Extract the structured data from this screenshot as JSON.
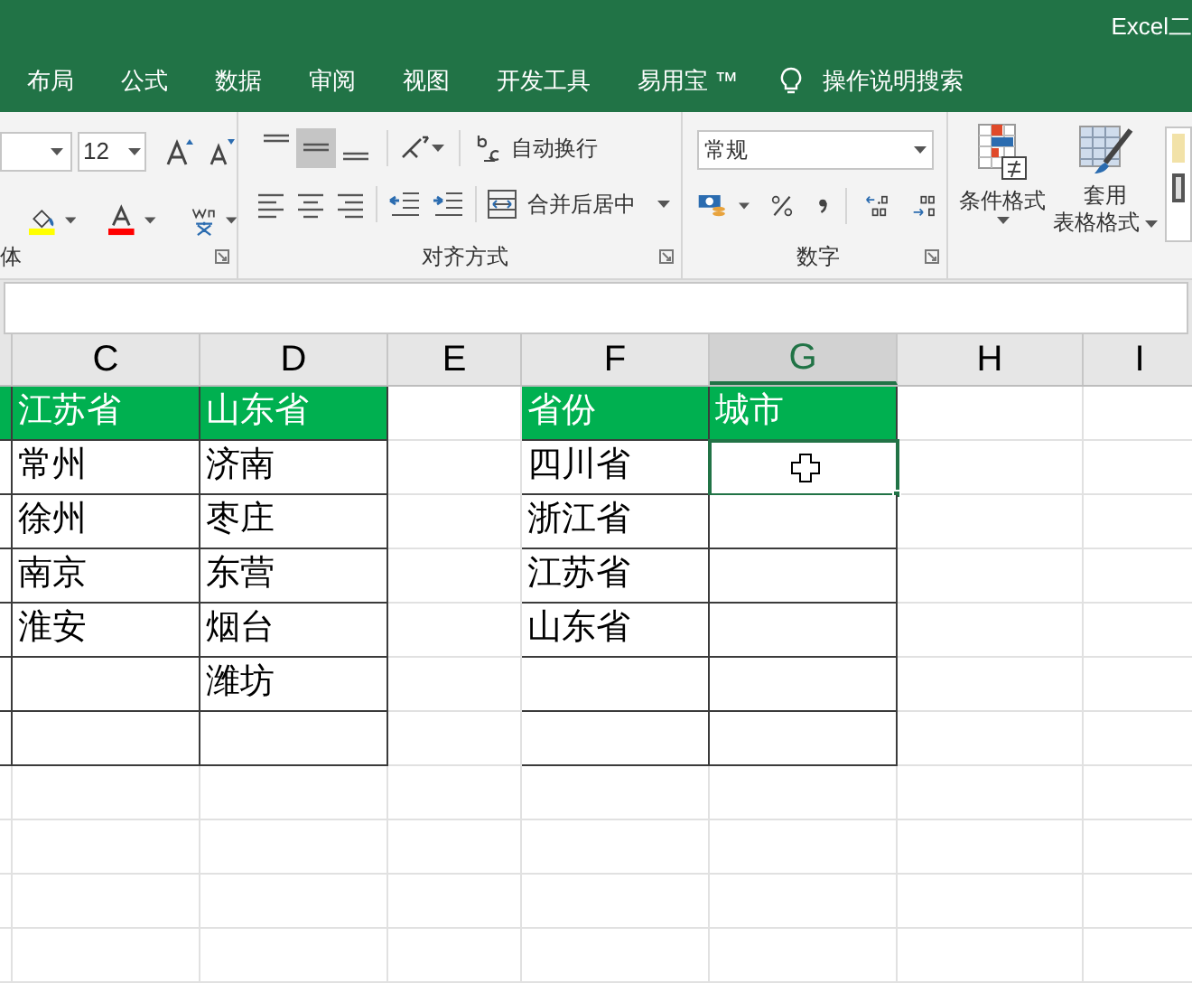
{
  "window": {
    "title": "Excel二"
  },
  "ribbon_tabs": [
    {
      "label": "布局",
      "selected": false
    },
    {
      "label": "公式",
      "selected": false
    },
    {
      "label": "数据",
      "selected": false
    },
    {
      "label": "审阅",
      "selected": false
    },
    {
      "label": "视图",
      "selected": false
    },
    {
      "label": "开发工具",
      "selected": false
    },
    {
      "label": "易用宝 ™",
      "selected": false
    }
  ],
  "tell_me": {
    "placeholder": "操作说明搜索"
  },
  "font_group": {
    "label": "体",
    "font_size": "12"
  },
  "alignment_group": {
    "label": "对齐方式",
    "vertical_align": [
      {
        "selected": false
      },
      {
        "selected": true
      },
      {
        "selected": false
      }
    ],
    "wrap_text": "自动换行",
    "merge_center": "合并后居中"
  },
  "number_group": {
    "label": "数字",
    "format": "常规"
  },
  "styles_group": {
    "conditional_format": "条件格式",
    "table_format": [
      "套用",
      "表格格式"
    ]
  },
  "columns": [
    {
      "label": "C",
      "selected": false
    },
    {
      "label": "D",
      "selected": false
    },
    {
      "label": "E",
      "selected": false
    },
    {
      "label": "F",
      "selected": false
    },
    {
      "label": "G",
      "selected": true
    },
    {
      "label": "H",
      "selected": false
    },
    {
      "label": "I",
      "selected": false
    }
  ],
  "tables": [
    {
      "header": [
        "江苏省",
        "山东省"
      ],
      "rows": [
        [
          {
            "text": "常州",
            "selected": false
          },
          {
            "text": "济南",
            "selected": false
          }
        ],
        [
          {
            "text": "徐州",
            "selected": false
          },
          {
            "text": "枣庄",
            "selected": false
          }
        ],
        [
          {
            "text": "南京",
            "selected": false
          },
          {
            "text": "东营",
            "selected": false
          }
        ],
        [
          {
            "text": "淮安",
            "selected": false
          },
          {
            "text": "烟台",
            "selected": false
          }
        ],
        [
          {
            "selected": false
          },
          {
            "text": "潍坊",
            "selected": false
          }
        ],
        [
          {
            "selected": false
          },
          {
            "selected": false
          }
        ]
      ]
    },
    {
      "header": [
        "省份",
        "城市"
      ],
      "rows": [
        [
          {
            "text": "四川省",
            "selected": false
          },
          {
            "selected": true
          }
        ],
        [
          {
            "text": "浙江省",
            "selected": false
          },
          {
            "selected": false
          }
        ],
        [
          {
            "text": "江苏省",
            "selected": false
          },
          {
            "selected": false
          }
        ],
        [
          {
            "text": "山东省",
            "selected": false
          },
          {
            "selected": false
          }
        ],
        [
          {
            "selected": false
          },
          {
            "selected": false
          }
        ],
        [
          {
            "selected": false
          },
          {
            "selected": false
          }
        ]
      ]
    }
  ]
}
